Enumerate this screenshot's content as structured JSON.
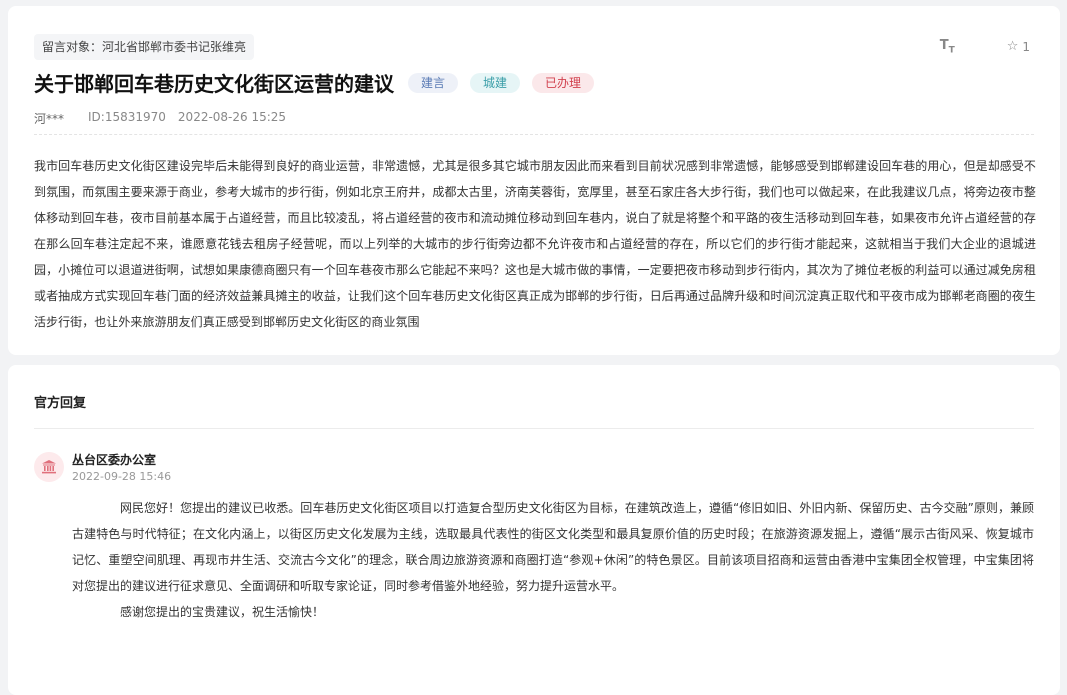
{
  "message": {
    "target": "留言对象：河北省邯郸市委书记张维亮",
    "font_size_label": "T",
    "favorite_count": "1",
    "title": "关于邯郸回车巷历史文化街区运营的建议",
    "tags": [
      "建言",
      "城建",
      "已办理"
    ],
    "author": "河***",
    "id": "ID:15831970",
    "date": "2022-08-26 15:25",
    "content": "我市回车巷历史文化街区建设完毕后未能得到良好的商业运营，非常遗憾，尤其是很多其它城市朋友因此而来看到目前状况感到非常遗憾，能够感受到邯郸建设回车巷的用心，但是却感受不到氛围，而氛围主要来源于商业，参考大城市的步行街，例如北京王府井，成都太古里，济南芙蓉街，宽厚里，甚至石家庄各大步行街，我们也可以做起来，在此我建议几点，将旁边夜市整体移动到回车巷，夜市目前基本属于占道经营，而且比较凌乱，将占道经营的夜市和流动摊位移动到回车巷内，说白了就是将整个和平路的夜生活移动到回车巷，如果夜市允许占道经营的存在那么回车巷注定起不来，谁愿意花钱去租房子经营呢，而以上列举的大城市的步行街旁边都不允许夜市和占道经营的存在，所以它们的步行街才能起来，这就相当于我们大企业的退城进园，小摊位可以退道进街啊，试想如果康德商圈只有一个回车巷夜市那么它能起不来吗？这也是大城市做的事情，一定要把夜市移动到步行街内，其次为了摊位老板的利益可以通过减免房租或者抽成方式实现回车巷门面的经济效益兼具摊主的收益，让我们这个回车巷历史文化街区真正成为邯郸的步行街，日后再通过品牌升级和时间沉淀真正取代和平夜市成为邯郸老商圈的夜生活步行街，也让外来旅游朋友们真正感受到邯郸历史文化街区的商业氛围"
  },
  "reply": {
    "heading": "官方回复",
    "org_name": "丛台区委办公室",
    "time": "2022-09-28 15:46",
    "paragraphs": [
      "网民您好！您提出的建议已收悉。回车巷历史文化街区项目以打造复合型历史文化街区为目标，在建筑改造上，遵循“修旧如旧、外旧内新、保留历史、古今交融”原则，兼顾古建特色与时代特征；在文化内涵上，以街区历史文化发展为主线，选取最具代表性的街区文化类型和最具复原价值的历史时段；在旅游资源发掘上，遵循“展示古街风采、恢复城市记忆、重塑空间肌理、再现市井生活、交流古今文化”的理念，联合周边旅游资源和商圈打造“参观+休闲”的特色景区。目前该项目招商和运营由香港中宝集团全权管理，中宝集团将对您提出的建议进行征求意见、全面调研和听取专家论证，同时参考借鉴外地经验，努力提升运营水平。",
      "感谢您提出的宝贵建议，祝生活愉快！"
    ]
  },
  "icons": {
    "font": "font-size-icon",
    "star": "star-outline-icon",
    "org": "government-building-icon"
  }
}
